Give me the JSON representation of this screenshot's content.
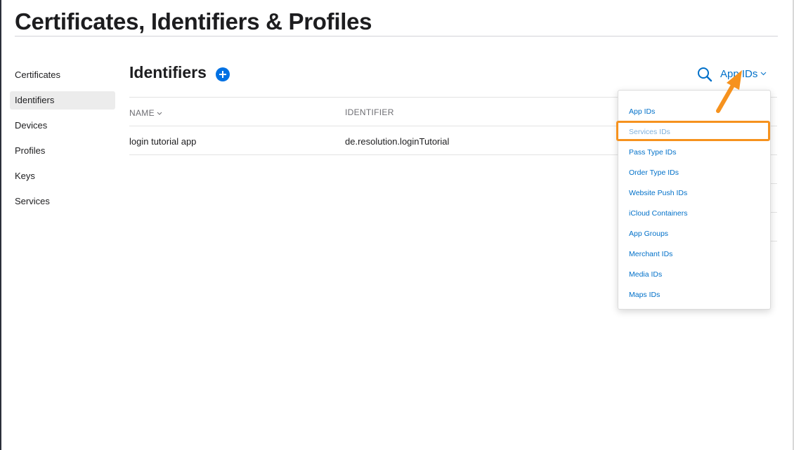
{
  "page": {
    "title": "Certificates, Identifiers & Profiles"
  },
  "sidebar": {
    "items": [
      {
        "label": "Certificates",
        "active": false
      },
      {
        "label": "Identifiers",
        "active": true
      },
      {
        "label": "Devices",
        "active": false
      },
      {
        "label": "Profiles",
        "active": false
      },
      {
        "label": "Keys",
        "active": false
      },
      {
        "label": "Services",
        "active": false
      }
    ]
  },
  "main": {
    "section_title": "Identifiers",
    "add_icon": "plus-circle-icon",
    "search_icon": "search-icon",
    "filter_selected": "App IDs",
    "table": {
      "columns": [
        "NAME",
        "IDENTIFIER"
      ],
      "rows": [
        {
          "name": "login tutorial app",
          "identifier": "de.resolution.loginTutorial"
        }
      ]
    }
  },
  "menu": {
    "items": [
      "App IDs",
      "Services IDs",
      "Pass Type IDs",
      "Order Type IDs",
      "Website Push IDs",
      "iCloud Containers",
      "App Groups",
      "Merchant IDs",
      "Media IDs",
      "Maps IDs"
    ],
    "highlighted": "Services IDs"
  },
  "colors": {
    "accent": "#0071e3",
    "link": "#0070c9",
    "annotation": "#f6921e",
    "active_sidebar_bg": "#ececec"
  }
}
